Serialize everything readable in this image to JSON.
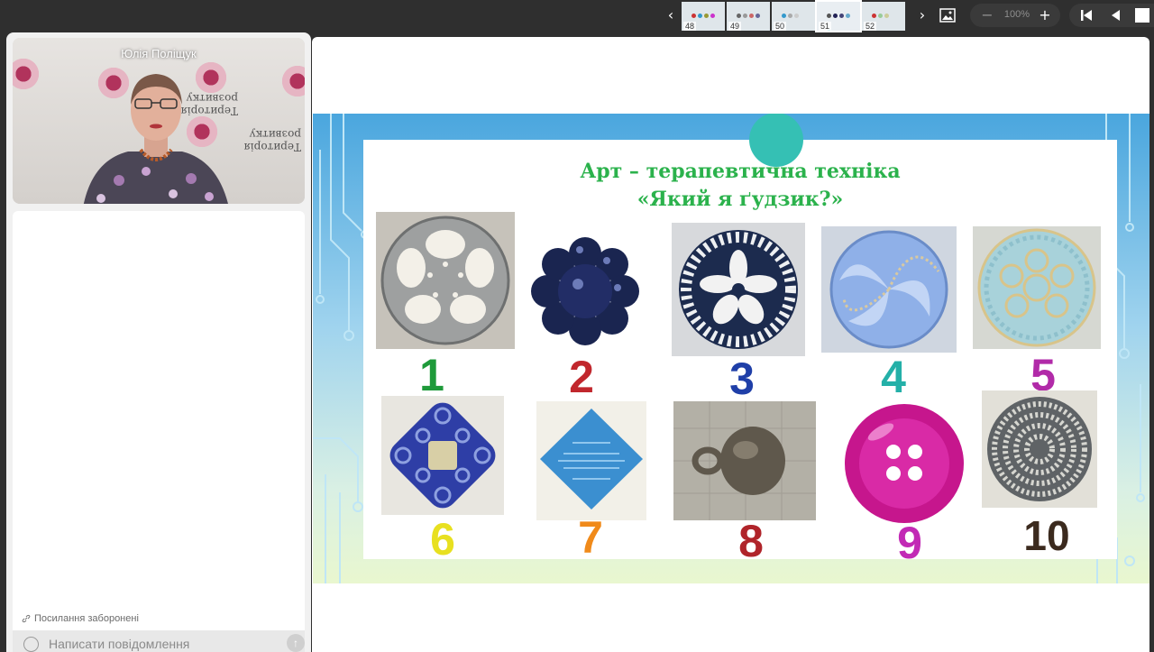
{
  "toolbar": {
    "prev_icon": "chevron-left-icon",
    "next_icon": "chevron-right-icon",
    "thumbnails": [
      {
        "label": "48",
        "active": false
      },
      {
        "label": "49",
        "active": false
      },
      {
        "label": "50",
        "active": false
      },
      {
        "label": "51",
        "active": true
      },
      {
        "label": "52",
        "active": false
      }
    ],
    "zoom_out_icon": "minus-icon",
    "zoom_level": "100%",
    "zoom_in_icon": "plus-icon",
    "image_icon": "image-icon",
    "first_icon": "skip-to-start-icon",
    "back_icon": "triangle-left-icon",
    "stop_icon": "square-icon"
  },
  "video": {
    "speaker_name": "Юлія Поліщук",
    "backdrop_texts": [
      "Територія розвитку",
      "Територія розвитку"
    ]
  },
  "chat": {
    "links_note": "Посилання заборонені",
    "input_placeholder": "Написати повідомлення"
  },
  "slide": {
    "title_line1": "Арт – терапевтична техніка",
    "title_line2": "«Який я ґудзик?»",
    "buttons": [
      {
        "number": "1",
        "color": "#1e9a3a"
      },
      {
        "number": "2",
        "color": "#c1272d"
      },
      {
        "number": "3",
        "color": "#1f3fa8"
      },
      {
        "number": "4",
        "color": "#24b0a8"
      },
      {
        "number": "5",
        "color": "#b12aa8"
      },
      {
        "number": "6",
        "color": "#e8e020"
      },
      {
        "number": "7",
        "color": "#f08a1a"
      },
      {
        "number": "8",
        "color": "#b0242a"
      },
      {
        "number": "9",
        "color": "#c22ab5"
      },
      {
        "number": "10",
        "color": "#3b2a1e"
      }
    ]
  }
}
